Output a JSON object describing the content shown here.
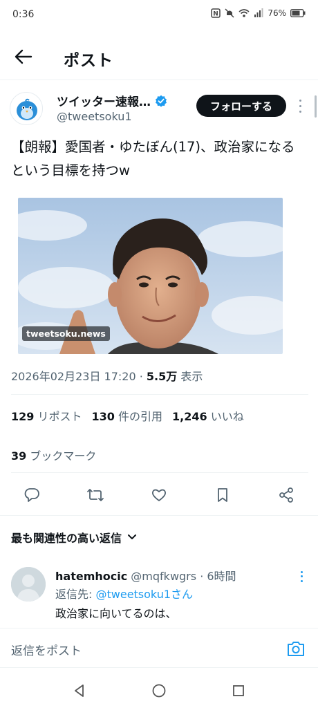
{
  "status": {
    "time": "0:36",
    "battery": "76%"
  },
  "header": {
    "title": "ポスト"
  },
  "author": {
    "name": "ツイッター速報…",
    "handle": "@tweetsoku1",
    "follow_label": "フォローする"
  },
  "tweet": {
    "text": "【朗報】愛国者・ゆたぼん(17)、政治家になるという目標を持つw",
    "watermark": "tweetsoku.news",
    "timestamp": "2026年02月23日 17:20",
    "separator": " · ",
    "views_count": "5.5万",
    "views_label": " 表示"
  },
  "stats": {
    "retweets": {
      "count": "129",
      "label": "リポスト"
    },
    "quotes": {
      "count": "130",
      "label": "件の引用"
    },
    "likes": {
      "count": "1,246",
      "label": "いいね"
    },
    "bookmarks": {
      "count": "39",
      "label": "ブックマーク"
    }
  },
  "actions": [
    "reply-icon",
    "retweet-icon",
    "like-icon",
    "bookmark-icon",
    "share-icon"
  ],
  "replies": {
    "sort_label": "最も関連性の高い返信",
    "items": [
      {
        "name": "hatemhocic",
        "handle": "@mqfkwgrs",
        "time": "6時間",
        "reply_to_prefix": "返信先: ",
        "reply_to": "@tweetsoku1さん",
        "text": "政治家に向いてるのは、"
      }
    ]
  },
  "composer": {
    "placeholder": "返信をポスト"
  },
  "colors": {
    "accent": "#1d9bf0",
    "text": "#0f1419",
    "secondary": "#536471"
  }
}
